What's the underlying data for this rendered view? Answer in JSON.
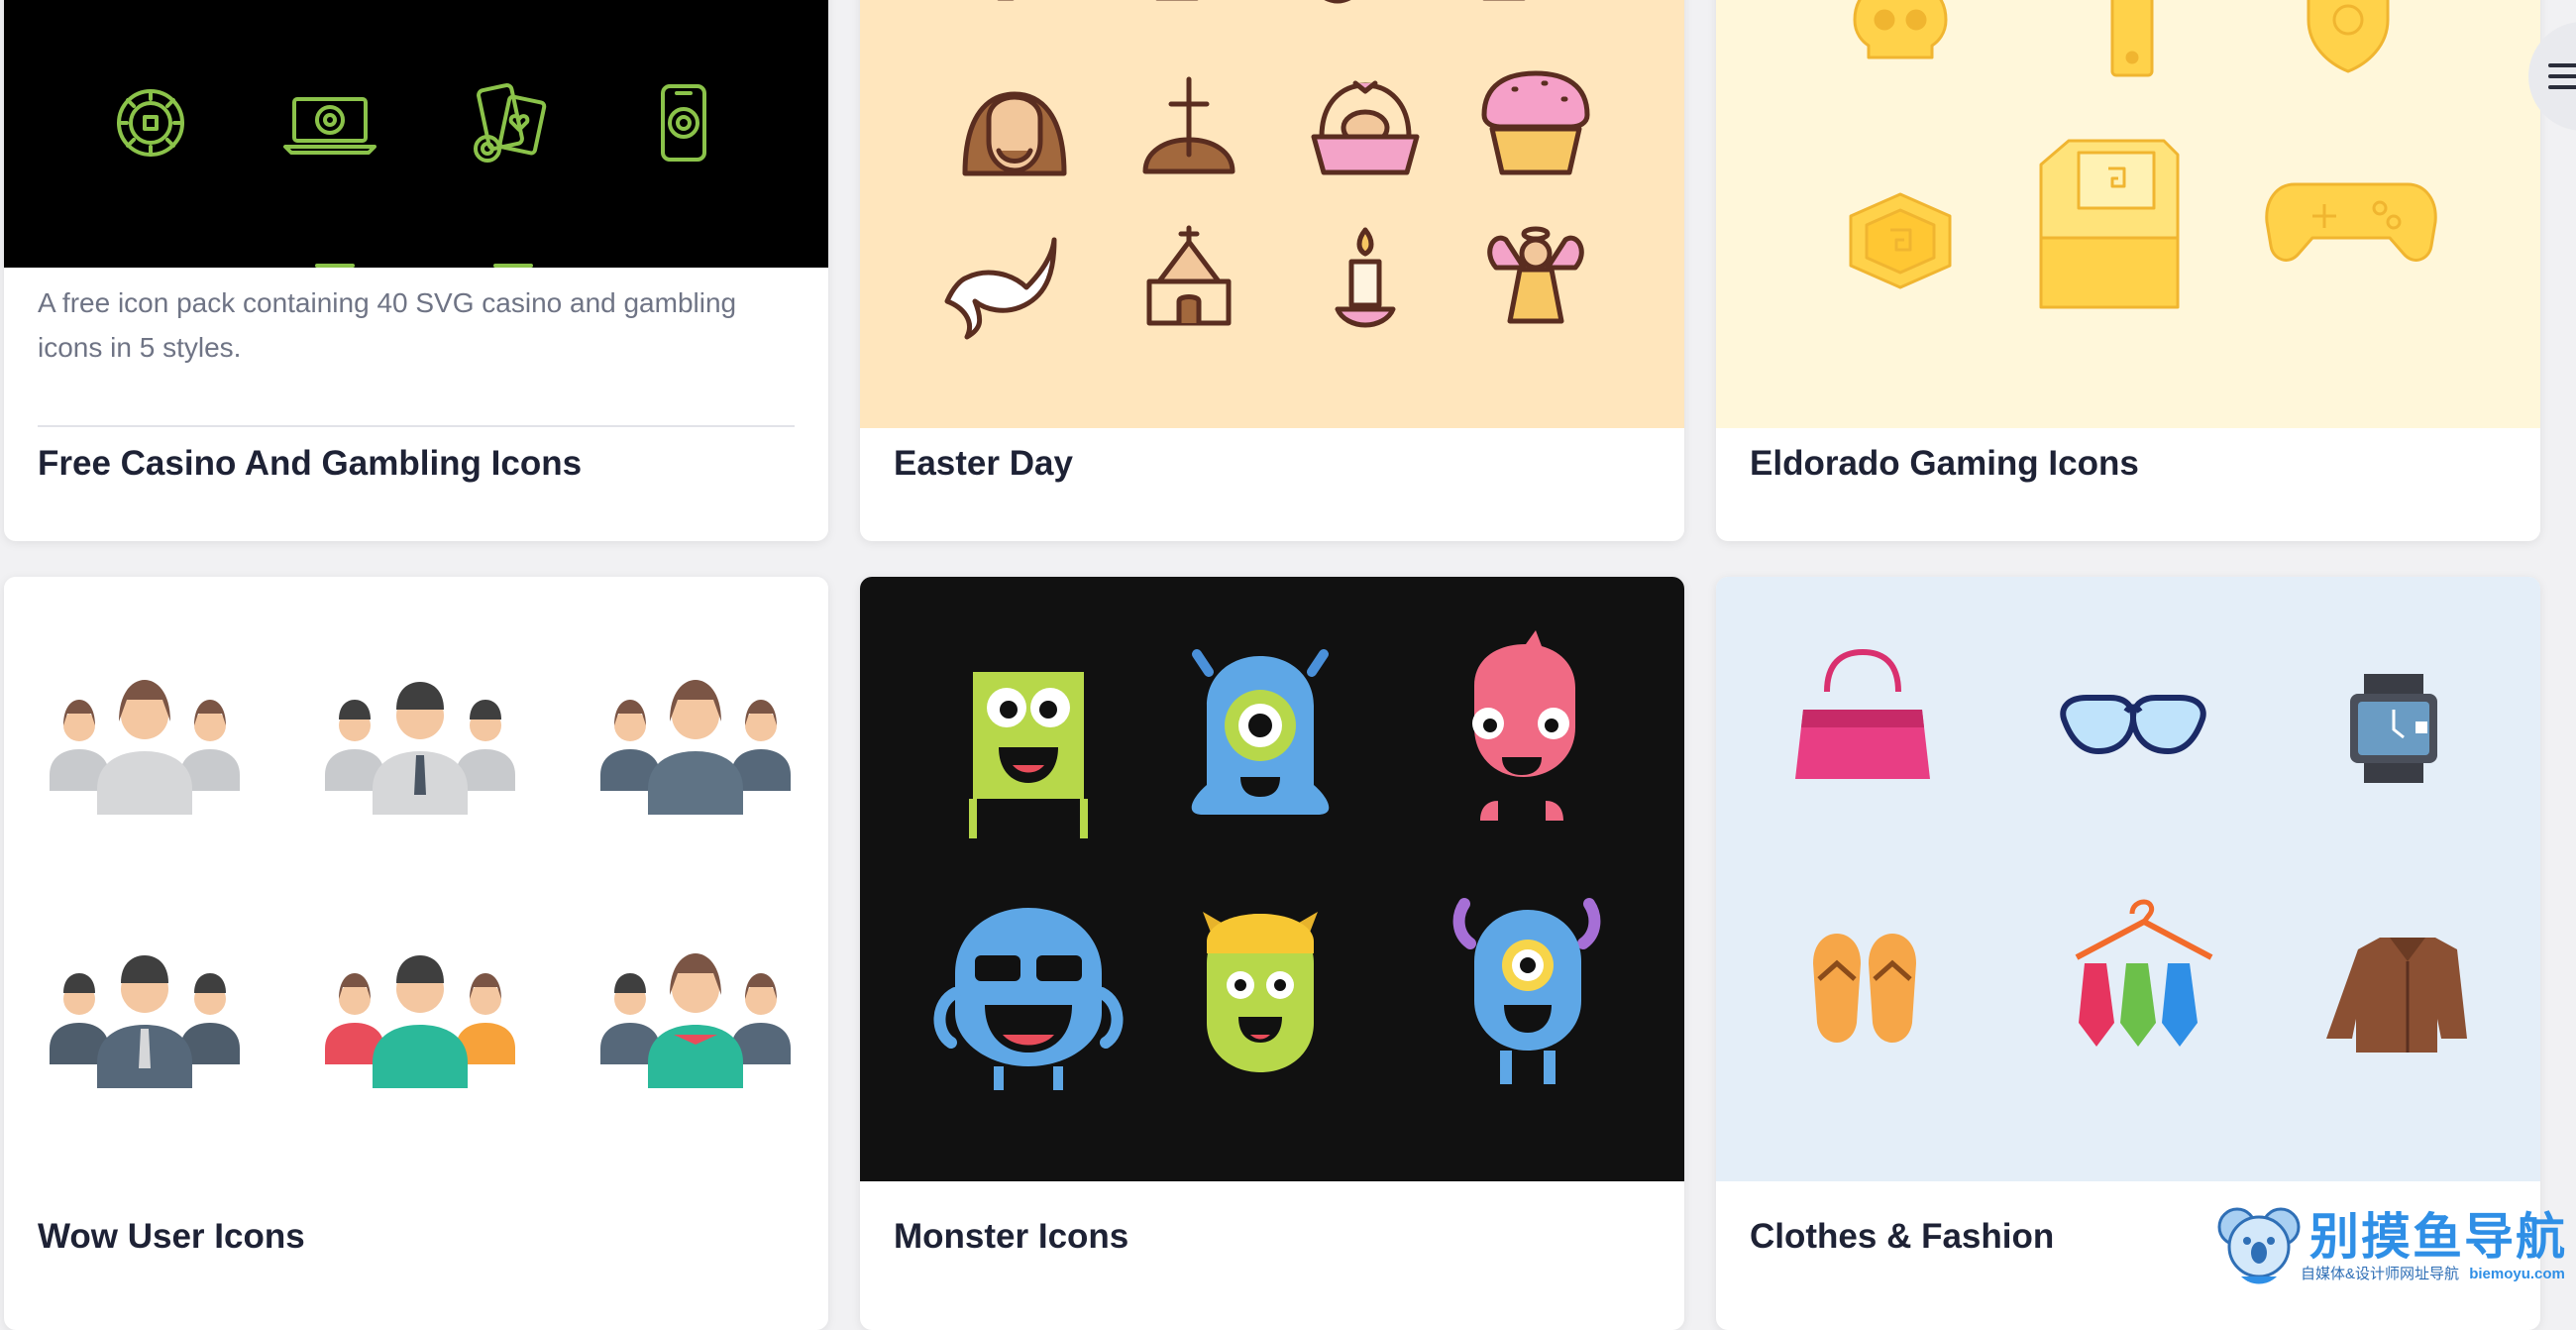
{
  "cards": [
    {
      "title": "Free Casino And Gambling Icons",
      "description": "A free icon pack containing 40 SVG casino and gambling icons in 5 styles.",
      "background": "#000000",
      "icon_color": "#8bc34a",
      "icons": [
        "casino-chip-icon",
        "laptop-roulette-icon",
        "phone-cards-icon",
        "phone-chip-icon"
      ]
    },
    {
      "title": "Easter Day",
      "background": "#ffe6bd",
      "icons": [
        "jesus-icon",
        "grave-cross-icon",
        "easter-basket-icon",
        "cupcake-icon",
        "dove-icon",
        "church-icon",
        "candle-icon",
        "angel-icon"
      ]
    },
    {
      "title": "Eldorado Gaming Icons",
      "background": "#fff7da",
      "icon_color": "#ffd24a",
      "icons": [
        "skull-icon",
        "console-tower-icon",
        "shield-icon",
        "coin-icon",
        "arcade-machine-icon",
        "gamepad-icon"
      ]
    },
    {
      "title": "Wow User Icons",
      "background": "#ffffff",
      "icons": [
        "user-group-women-icon",
        "user-group-men-icon",
        "user-group-dark-women-icon",
        "user-group-business-icon",
        "user-group-color-icon",
        "user-group-mixed-icon"
      ]
    },
    {
      "title": "Monster Icons",
      "background": "#111111",
      "icons": [
        "green-box-monster-icon",
        "blue-cyclops-monster-icon",
        "pink-monster-icon",
        "blue-sunglasses-monster-icon",
        "green-horned-monster-icon",
        "blue-horned-cyclops-icon"
      ]
    },
    {
      "title": "Clothes & Fashion",
      "background": "#e4eef8",
      "icons": [
        "handbag-icon",
        "sunglasses-icon",
        "wristwatch-icon",
        "flip-flops-icon",
        "ties-hanger-icon",
        "jacket-icon"
      ]
    }
  ],
  "watermark": {
    "title": "别摸鱼导航",
    "subtitle": "自媒体&设计师网址导航",
    "url": "biemoyu.com"
  },
  "menu_icon": "hamburger-icon"
}
